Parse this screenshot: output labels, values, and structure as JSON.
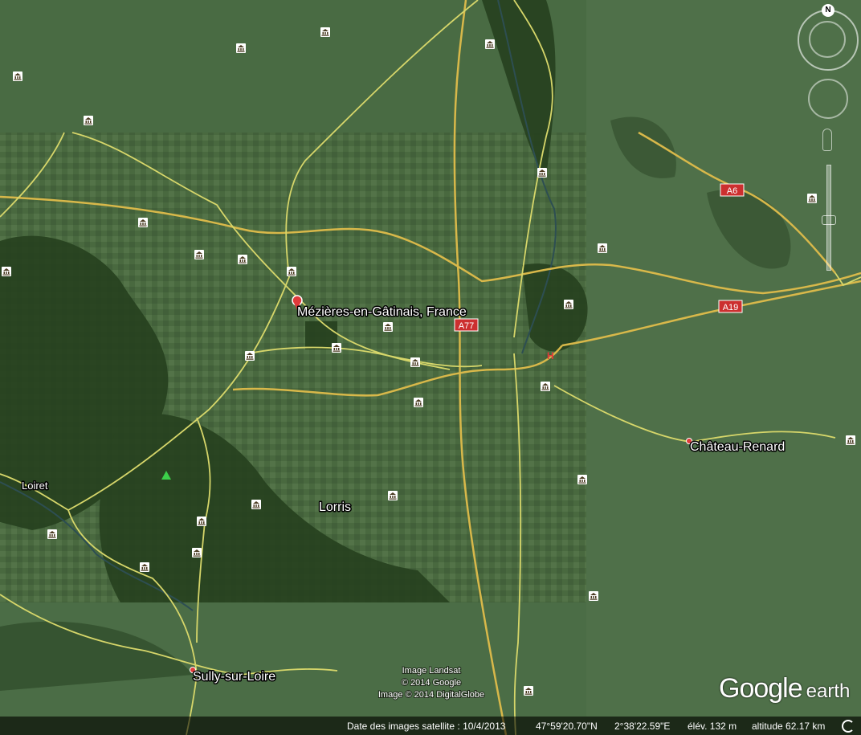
{
  "map": {
    "places": {
      "main": "Mézières-en-Gâtinais, France",
      "chateau": "Château-Renard",
      "lorris": "Lorris",
      "sully": "Sully-sur-Loire",
      "loiret": "Loiret"
    },
    "roads": {
      "a6": "A6",
      "a19": "A19",
      "a77": "A77"
    },
    "attribution": [
      "Image Landsat",
      "© 2014 Google",
      "Image © 2014 DigitalGlobe"
    ],
    "compass_letter": "N",
    "colors": {
      "road_major": "#d8b84a",
      "road_minor": "#d6d66a",
      "shield": "#cc2f2f"
    }
  },
  "status": {
    "imagery_date": "Date des images satellite : 10/4/2013",
    "latitude": "47°59'20.70\"N",
    "longitude": "2°38'22.59\"E",
    "elevation": "élév.  132 m",
    "altitude": "altitude  62.17 km"
  },
  "logo": {
    "google": "Google",
    "earth": "earth"
  },
  "icons": [
    "compass-icon",
    "look-control-icon",
    "street-view-icon",
    "zoom-slider-icon",
    "placemark-pin-icon",
    "poi-icon",
    "loading-icon"
  ]
}
